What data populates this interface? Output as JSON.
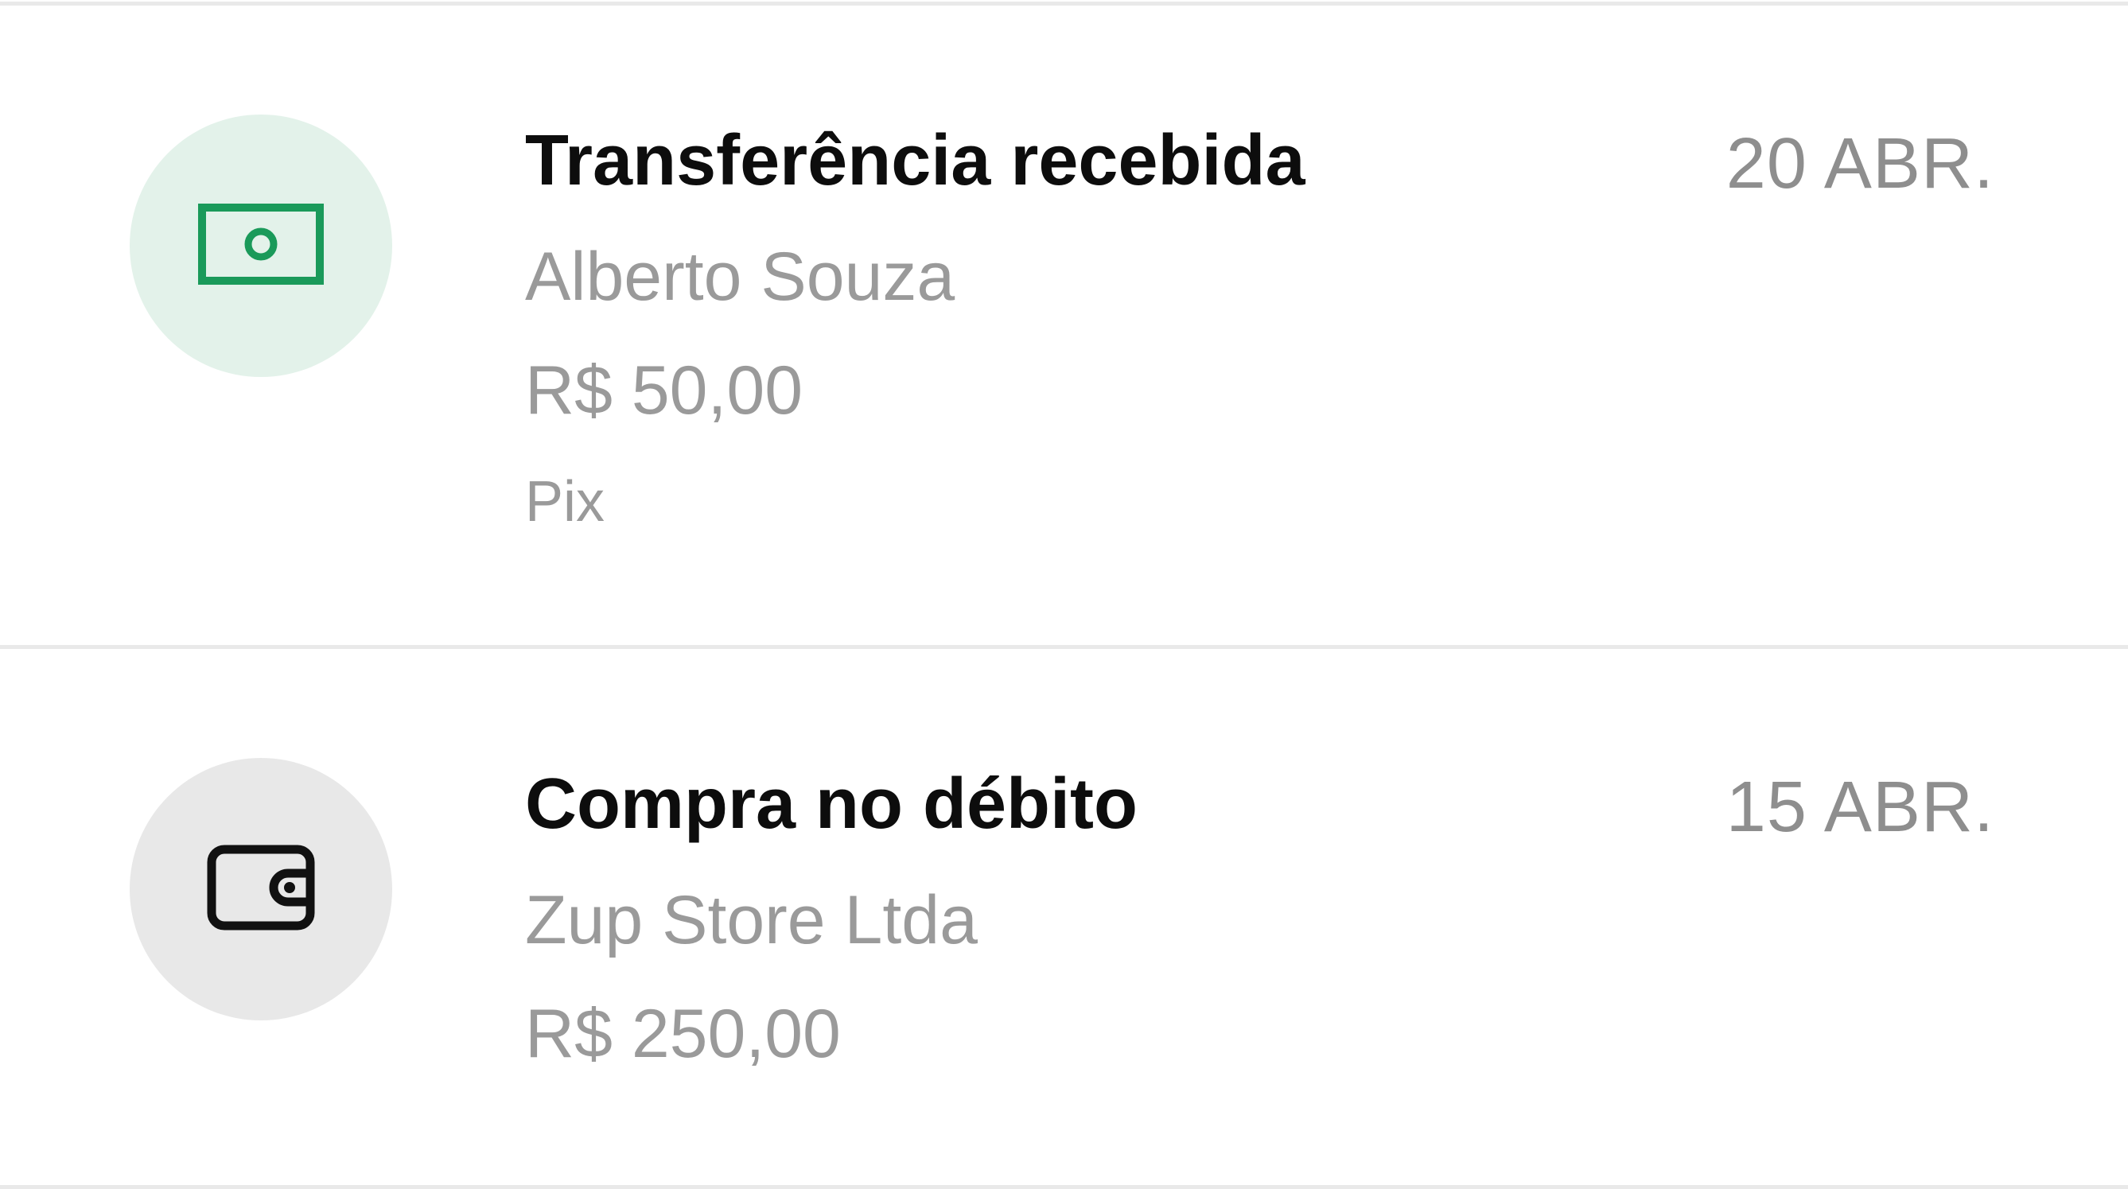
{
  "colors": {
    "green_accent": "#1a9a5a",
    "green_icon_bg": "#e3f2ea",
    "gray_icon_bg": "#e8e8e8",
    "title_text": "#0d0d0d",
    "secondary_text": "#9a9a9a",
    "divider": "#e9e9e9"
  },
  "transactions": [
    {
      "icon": "banknote-icon",
      "title": "Transferência recebida",
      "date": "20 ABR.",
      "counterparty": "Alberto Souza",
      "amount": "R$ 50,00",
      "method": "Pix"
    },
    {
      "icon": "wallet-icon",
      "title": "Compra no débito",
      "date": "15 ABR.",
      "counterparty": "Zup Store Ltda",
      "amount": "R$ 250,00"
    }
  ]
}
